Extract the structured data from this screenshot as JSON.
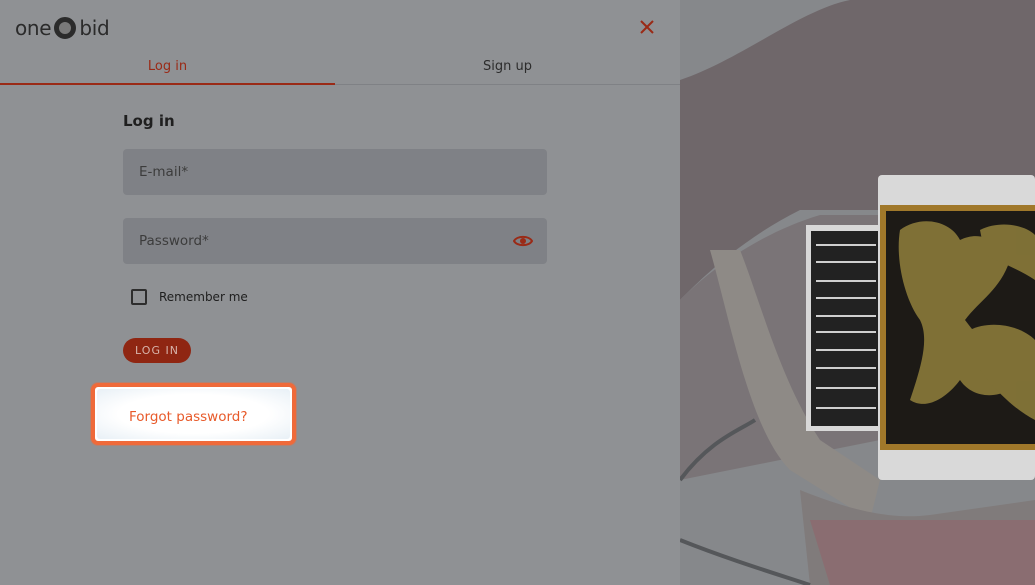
{
  "brand": {
    "left": "one",
    "right": "bid"
  },
  "tabs": [
    {
      "label": "Log in",
      "active": true
    },
    {
      "label": "Sign up",
      "active": false
    }
  ],
  "form": {
    "title": "Log in",
    "email_placeholder": "E-mail*",
    "password_placeholder": "Password*",
    "remember_label": "Remember me",
    "submit_label": "LOG IN",
    "forgot_label": "Forgot password?"
  },
  "colors": {
    "accent": "#9a2a16",
    "highlight": "#ef6a3a",
    "overlay": "#8f9194"
  },
  "icons": {
    "close": "close-icon",
    "eye": "eye-icon",
    "logo": "onebid-logo-icon"
  }
}
